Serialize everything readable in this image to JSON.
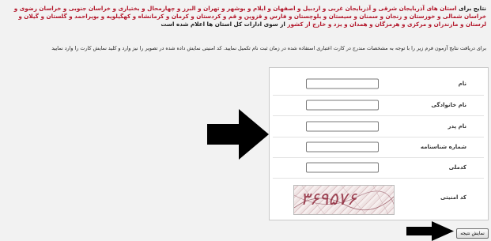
{
  "notice": {
    "lead": "نتایج برای",
    "provinces": "استان های آذربایجان شرقی و آذربایجان غربی و اردبیل و اصفهان و ایلام و بوشهر و تهران و البرز و چهارمحال و بختیاری و خراسان جنوبی و خراسان رضوی و خراسان شمالی و خوزستان و زنجان و سمنان و سیستان و بلوچستان و فارس و قزوین و قم و کردستان و کرمان و کرمانشاه و کهگیلویه و بویراحمد و گلستان و گیلان و لرستان و مازندران و مرکزی و هرمزگان و همدان و یزد و خارج از کشور",
    "tail": "از سوی ادارات کل استان ها اعلام شده است"
  },
  "instruction": "برای دریافت نتایج آزمون فرم زیر را با توجه به مشخصات مندرج در کارت اعتباری استفاده شده در زمان ثبت نام تکمیل نمایید. کد امنیتی نمایش داده شده در تصویر را نیز وارد و کلید نمایش کارت را وارد نمایید",
  "form": {
    "name_label": "نام",
    "family_label": "نام خانوادگی",
    "father_label": "نام پدر",
    "id_number_label": "شماره شناسنامه",
    "national_code_label": "کدملی",
    "security_code_label": "کد امنیتی",
    "captcha_text": "۳۶۹۵۷۶",
    "submit_label": "نمایش نتیجه"
  },
  "colors": {
    "accent_red": "#b3162a",
    "captcha_text": "#8b1f33"
  },
  "icons": {
    "arrow": "right-arrow-icon"
  }
}
